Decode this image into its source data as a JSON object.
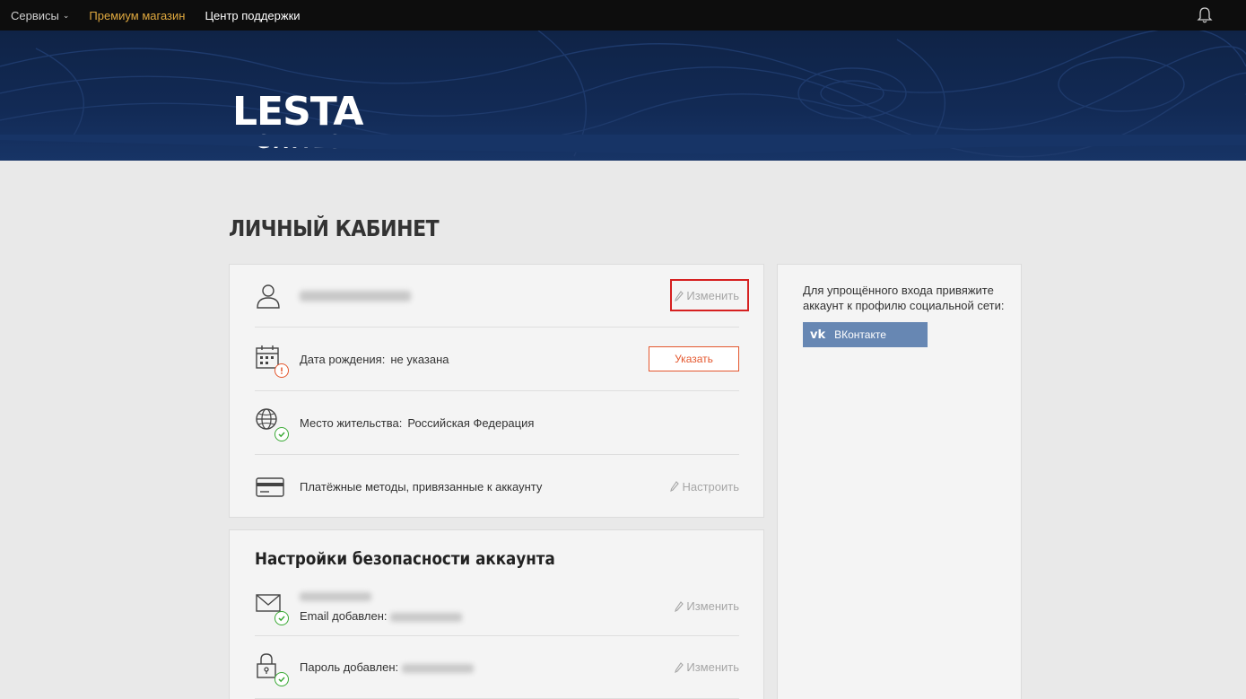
{
  "topnav": {
    "items": [
      {
        "label": "Сервисы",
        "has_dropdown": true
      },
      {
        "label": "Премиум магазин"
      },
      {
        "label": "Центр поддержки"
      }
    ],
    "bell_icon": "bell-icon"
  },
  "logo": {
    "line1": "LESTA",
    "line2": "GAMES"
  },
  "page": {
    "title": "ЛИЧНЫЙ КАБИНЕТ"
  },
  "profile": {
    "username_hidden": true,
    "edit_label": "Изменить",
    "birth": {
      "label": "Дата рождения:",
      "value": "не указана",
      "action_label": "Указать"
    },
    "residence": {
      "label": "Место жительства:",
      "value": "Российская Федерация"
    },
    "payments": {
      "label": "Платёжные методы, привязанные к аккаунту",
      "action_label": "Настроить"
    }
  },
  "security": {
    "title": "Настройки безопасности аккаунта",
    "email": {
      "label": "Email добавлен:",
      "edit_label": "Изменить"
    },
    "password": {
      "label": "Пароль добавлен:",
      "edit_label": "Изменить"
    }
  },
  "social": {
    "text": "Для упрощённого входа привяжите аккаунт к профилю социальной сети:",
    "vk_logo": "vk",
    "vk_label": "ВКонтакте"
  },
  "colors": {
    "accent_orange": "#e4572e",
    "premium_gold": "#e0a93f",
    "vk_blue": "#6787b3",
    "success_green": "#3aaa35",
    "banner_navy": "#122a55"
  }
}
